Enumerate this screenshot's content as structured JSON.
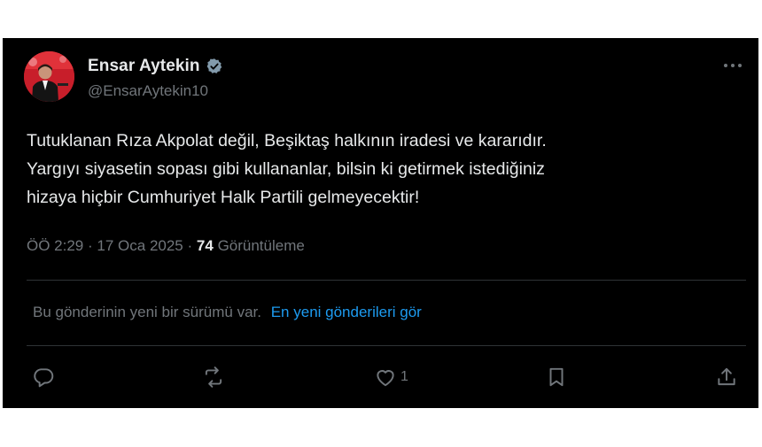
{
  "author": {
    "display_name": "Ensar Aytekin",
    "handle": "@EnsarAytekin10",
    "verified": true
  },
  "tweet": {
    "text_lines": [
      "Tutuklanan Rıza Akpolat değil, Beşiktaş halkının iradesi ve kararıdır.",
      "Yargıyı siyasetin sopası gibi kullananlar, bilsin ki getirmek istediğiniz",
      "hizaya hiçbir Cumhuriyet Halk Partili gelmeyecektir!"
    ]
  },
  "meta": {
    "time": "ÖÖ 2:29",
    "sep1": "·",
    "date": "17 Oca 2025",
    "sep2": "·",
    "views_count": "74",
    "views_label": "Görüntüleme"
  },
  "notice": {
    "text": "Bu gönderinin yeni bir sürümü var.",
    "link": "En yeni gönderileri gör"
  },
  "actions": {
    "reply_count": "",
    "repost_count": "",
    "like_count": "1"
  },
  "icons": {
    "more": "more-horizontal-icon",
    "verified": "verified-badge-icon",
    "reply": "reply-icon",
    "repost": "repost-icon",
    "like": "heart-icon",
    "bookmark": "bookmark-icon",
    "share": "share-icon"
  },
  "colors": {
    "background": "#000000",
    "text": "#e7e9ea",
    "secondary": "#71767b",
    "link": "#1d9bf0",
    "divider": "#2f3336"
  }
}
